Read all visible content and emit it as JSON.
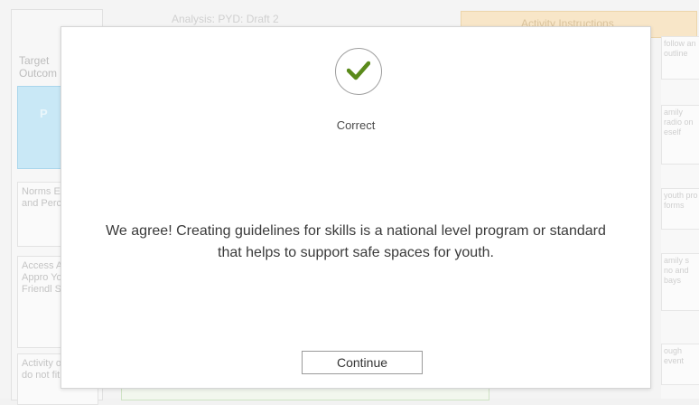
{
  "background": {
    "title": "Analysis: PYD: Draft 2",
    "left_labels": [
      "Target",
      "Outcom"
    ],
    "left_tile": "P",
    "left_blocks": [
      "Norms Expect and Percep",
      "Access Age-Appro Youth Friendl Service",
      "Activity option do not fit"
    ],
    "right_header": "Activity Instructions",
    "right_cells": [
      "follow an outline",
      "amily radio on eself",
      "youth pro forms",
      "amily s no and bays",
      "ough event"
    ]
  },
  "modal": {
    "icon": "checkmark-icon",
    "icon_color": "#5a8a1a",
    "status": "Correct",
    "feedback": "We agree! Creating guidelines for skills is a national level program or standard that helps to support safe spaces for youth.",
    "continue_label": "Continue"
  }
}
